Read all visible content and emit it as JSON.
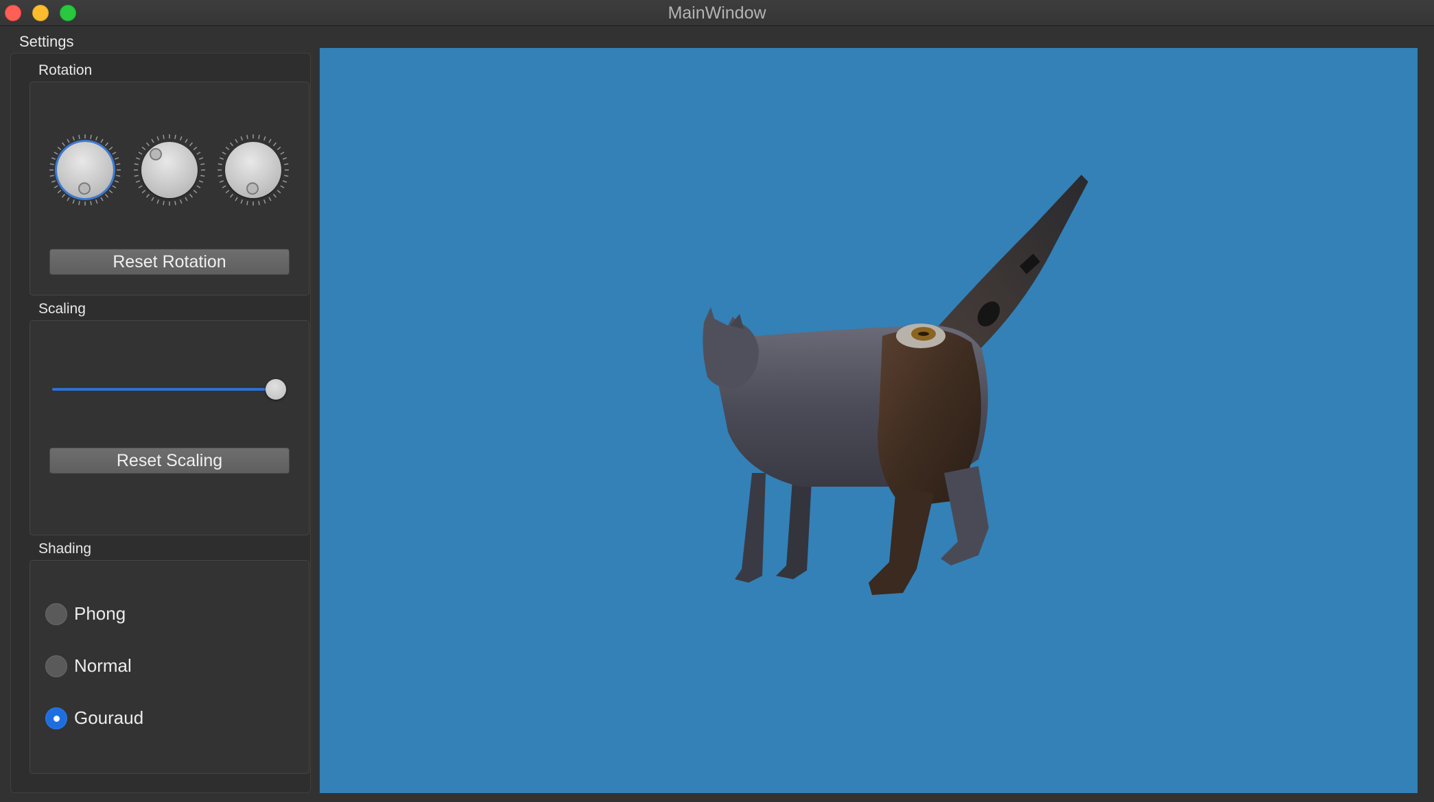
{
  "window": {
    "title": "MainWindow"
  },
  "settings": {
    "label": "Settings",
    "rotation": {
      "label": "Rotation",
      "dial_count": 3,
      "reset_label": "Reset Rotation"
    },
    "scaling": {
      "label": "Scaling",
      "slider_value_fraction": 1.0,
      "reset_label": "Reset Scaling"
    },
    "shading": {
      "label": "Shading",
      "options": [
        {
          "label": "Phong",
          "checked": false
        },
        {
          "label": "Normal",
          "checked": false
        },
        {
          "label": "Gouraud",
          "checked": true
        }
      ]
    }
  },
  "viewport": {
    "background_color": "#3381b7",
    "content": "3d-cat-model"
  },
  "colors": {
    "accent": "#2f6fd9",
    "close": "#fe5f57",
    "minimize": "#febc2e",
    "maximize": "#28c840"
  }
}
